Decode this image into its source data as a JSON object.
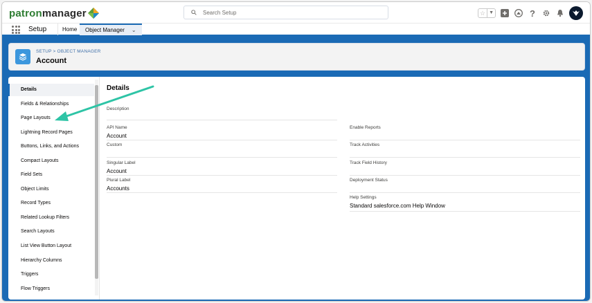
{
  "brand": {
    "logo_prefix": "patron",
    "logo_suffix": "manager"
  },
  "search": {
    "placeholder": "Search Setup"
  },
  "topbar_icons": [
    "star-icon",
    "add-icon",
    "trailhead-icon",
    "help-icon",
    "gear-icon",
    "bell-icon",
    "avatar"
  ],
  "nav": {
    "app_name": "Setup",
    "home": "Home",
    "object_manager": "Object Manager"
  },
  "header": {
    "breadcrumb": "SETUP > OBJECT MANAGER",
    "title": "Account"
  },
  "sidebar": {
    "items": [
      {
        "label": "Details",
        "active": true
      },
      {
        "label": "Fields & Relationships"
      },
      {
        "label": "Page Layouts"
      },
      {
        "label": "Lightning Record Pages"
      },
      {
        "label": "Buttons, Links, and Actions"
      },
      {
        "label": "Compact Layouts"
      },
      {
        "label": "Field Sets"
      },
      {
        "label": "Object Limits"
      },
      {
        "label": "Record Types"
      },
      {
        "label": "Related Lookup Filters"
      },
      {
        "label": "Search Layouts"
      },
      {
        "label": "List View Button Layout"
      },
      {
        "label": "Hierarchy Columns"
      },
      {
        "label": "Triggers"
      },
      {
        "label": "Flow Triggers"
      }
    ]
  },
  "details": {
    "title": "Details",
    "description_label": "Description",
    "left": [
      {
        "label": "API Name",
        "value": "Account"
      },
      {
        "label": "Custom",
        "value": ""
      },
      {
        "label": "Singular Label",
        "value": "Account"
      },
      {
        "label": "Plural Label",
        "value": "Accounts"
      }
    ],
    "right": [
      {
        "label": "Enable Reports",
        "value": ""
      },
      {
        "label": "Track Activities",
        "value": ""
      },
      {
        "label": "Track Field History",
        "value": ""
      },
      {
        "label": "Deployment Status",
        "value": ""
      },
      {
        "label": "Help Settings",
        "value": "Standard salesforce.com Help Window"
      }
    ]
  },
  "colors": {
    "brand_blue": "#1a6ab5",
    "object_icon": "#3c97dd",
    "arrow": "#2ec4a6"
  }
}
